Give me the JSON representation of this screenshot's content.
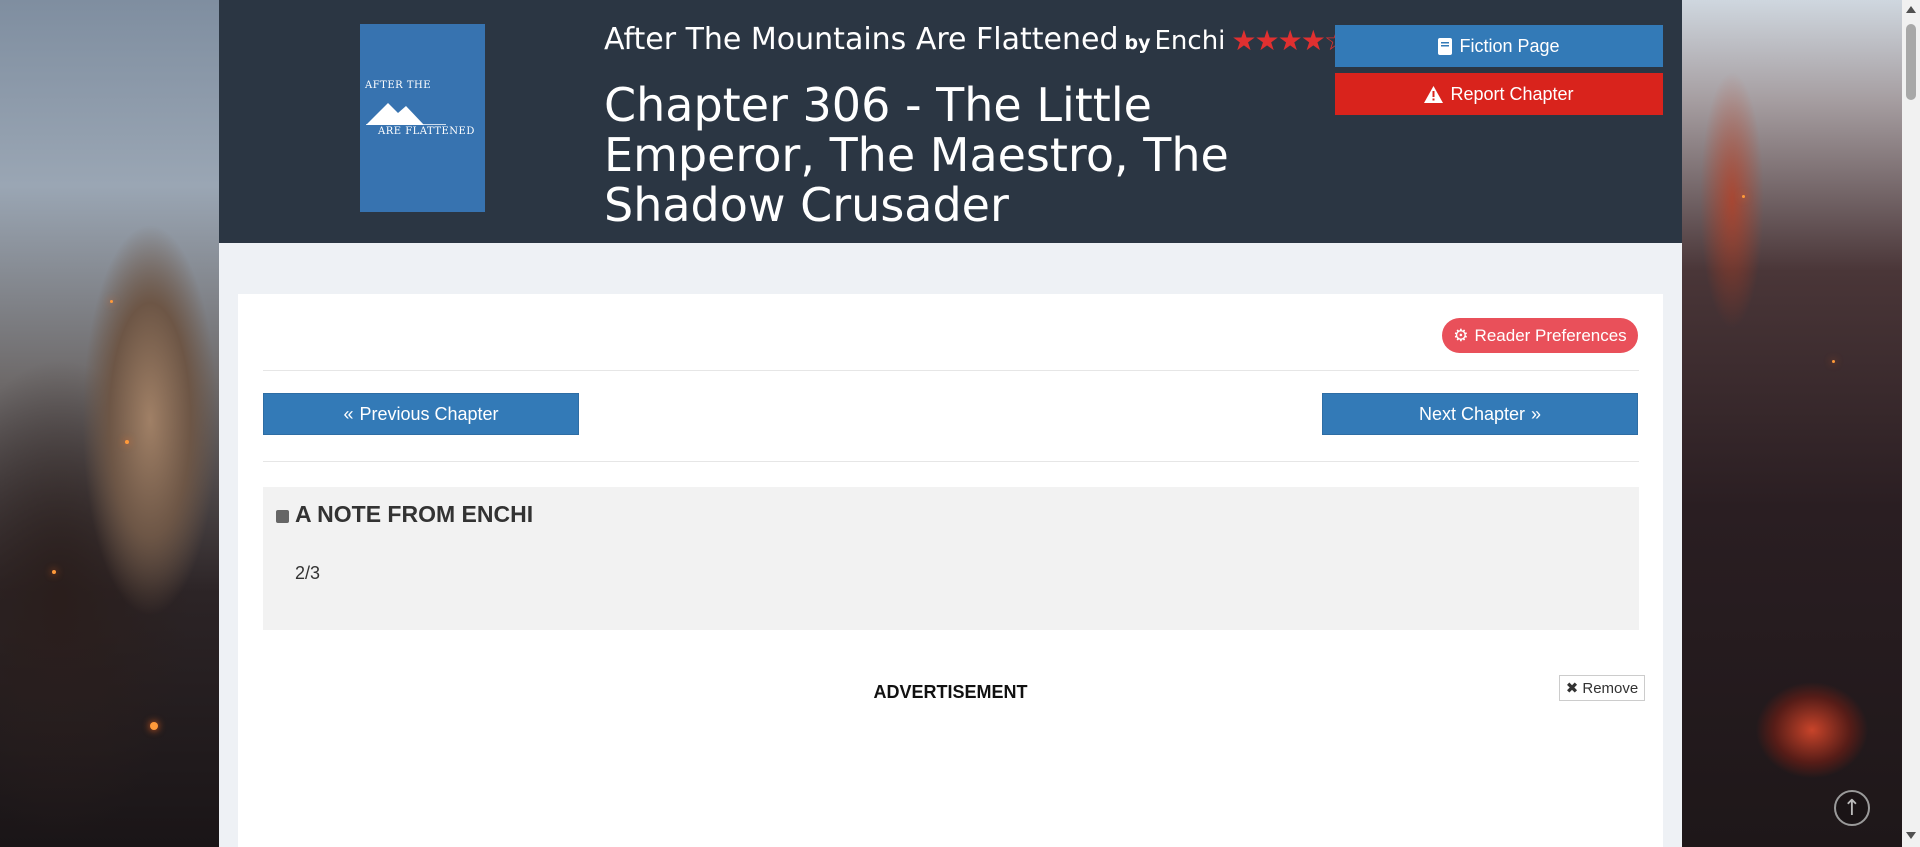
{
  "header": {
    "cover": {
      "line1": "AFTER THE",
      "line2": "ARE FLATTENED"
    },
    "fiction_title": "After The Mountains Are Flattened",
    "by": "by",
    "author": "Enchi",
    "rating_stars": 4,
    "stars_display": "★★★★☆",
    "chapter_title": "Chapter 306 - The Little Emperor, The Maestro, The Shadow Crusader",
    "fiction_page_label": "Fiction Page",
    "report_chapter_label": "Report Chapter"
  },
  "toolbar": {
    "reader_prefs_label": "Reader Preferences"
  },
  "nav": {
    "prev_label": "Previous Chapter",
    "next_label": "Next Chapter"
  },
  "note": {
    "title": "A NOTE FROM ENCHI",
    "body": "2/3"
  },
  "ad": {
    "label": "ADVERTISEMENT",
    "remove_label": "Remove"
  },
  "colors": {
    "header_bg": "#2b3643",
    "primary_blue": "#337ab7",
    "danger_red": "#d9231c",
    "prefs_pink": "#e9505a",
    "star_red": "#e03030"
  }
}
